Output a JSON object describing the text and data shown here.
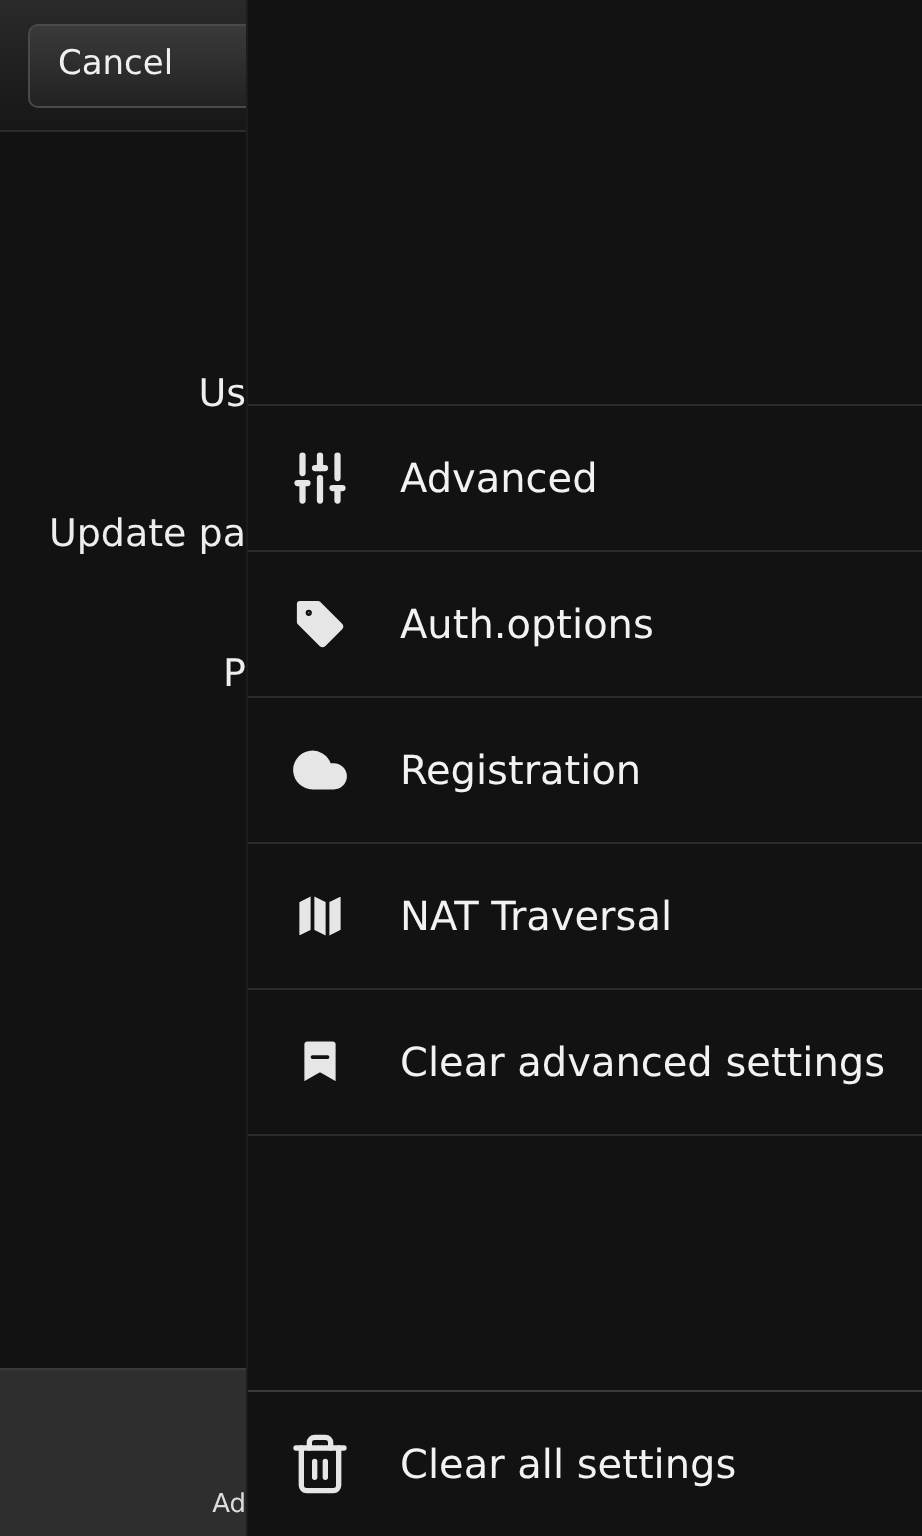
{
  "background_page": {
    "cancel_button": "Cancel",
    "labels": [
      "Us",
      "Update pa",
      "P"
    ],
    "bottom_bar_label": "Ad"
  },
  "menu": {
    "items": [
      {
        "kind": "sliders",
        "label": "Advanced"
      },
      {
        "kind": "tag",
        "label": "Auth.options"
      },
      {
        "kind": "cloud",
        "label": "Registration"
      },
      {
        "kind": "map",
        "label": "NAT Traversal"
      },
      {
        "kind": "bookmark",
        "label": "Clear advanced settings"
      }
    ],
    "bottom_item": {
      "kind": "trash",
      "label": "Clear all settings"
    }
  }
}
